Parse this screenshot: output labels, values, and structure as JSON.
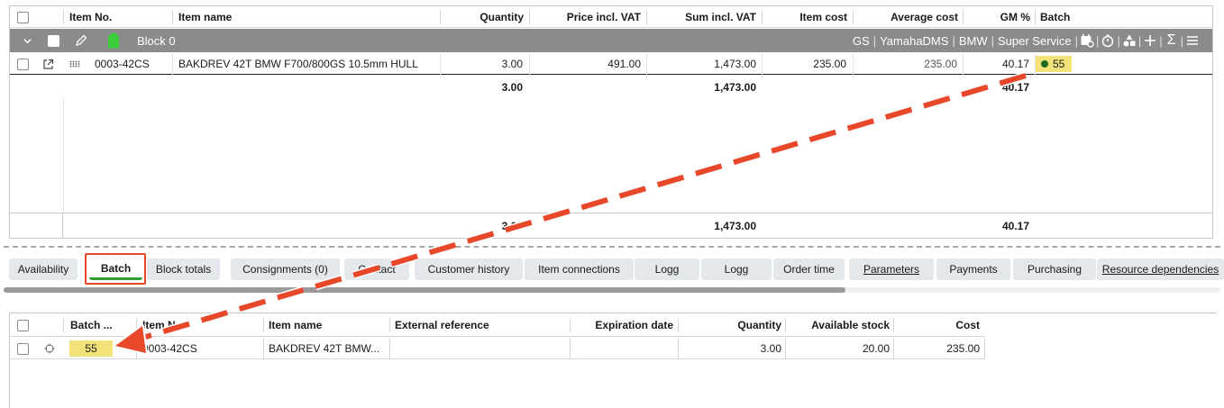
{
  "top_grid": {
    "headers": {
      "item_no": "Item No.",
      "item_name": "Item name",
      "quantity": "Quantity",
      "price": "Price incl. VAT",
      "sum": "Sum incl. VAT",
      "item_cost": "Item cost",
      "avg_cost": "Average cost",
      "gm": "GM %",
      "batch": "Batch"
    },
    "block": {
      "label": "Block 0",
      "tags": [
        "GS",
        "YamahaDMS",
        "BMW",
        "Super Service"
      ]
    },
    "row": {
      "item_no": "0003-42CS",
      "item_name": "BAKDREV 42T BMW F700/800GS 10.5mm HULL",
      "quantity": "3.00",
      "price": "491.00",
      "sum": "1,473.00",
      "item_cost": "235.00",
      "avg_cost": "235.00",
      "gm": "40.17",
      "batch": "55"
    },
    "subtotal": {
      "quantity": "3.00",
      "sum": "1,473.00",
      "gm": "40.17"
    },
    "total": {
      "quantity": "3.00",
      "sum": "1,473.00",
      "gm": "40.17"
    }
  },
  "tabs": [
    "Availability",
    "Batch",
    "Block totals",
    "Consignments (0)",
    "Contact",
    "Customer history",
    "Item connections",
    "Logg",
    "Logg",
    "Order time",
    "Parameters",
    "Payments",
    "Purchasing",
    "Resource dependencies"
  ],
  "bottom_grid": {
    "headers": {
      "batch": "Batch ...",
      "item_no": "Item No",
      "item_name": "Item name",
      "ext_ref": "External reference",
      "expiration": "Expiration date",
      "quantity": "Quantity",
      "available": "Available stock",
      "cost": "Cost"
    },
    "row": {
      "batch": "55",
      "item_no": "0003-42CS",
      "item_name": "BAKDREV 42T BMW...",
      "ext_ref": "",
      "expiration": "",
      "quantity": "3.00",
      "available": "20.00",
      "cost": "235.00"
    }
  },
  "colors": {
    "accent_arrow": "#e8482a",
    "batch_highlight": "#f2e27a",
    "active_tab_underline": "#2ca02c",
    "block_row_bg": "#8b8b8b"
  },
  "icons": [
    "chevron-down-icon",
    "pencil-icon",
    "battery-icon",
    "external-link-icon",
    "drag-handle-icon",
    "calendar-settings-icon",
    "timer-icon",
    "shapes-icon",
    "plus-icon",
    "sigma-icon",
    "menu-icon",
    "crosshair-icon"
  ]
}
